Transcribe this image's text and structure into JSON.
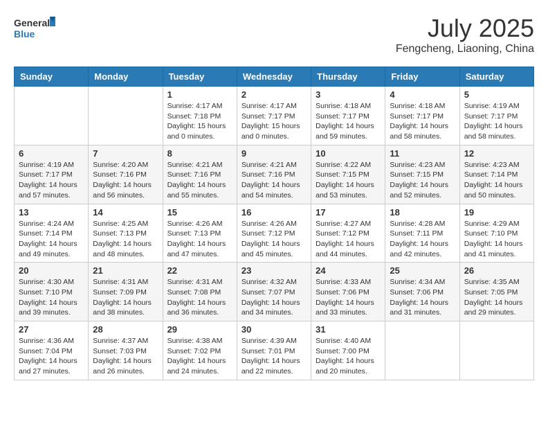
{
  "header": {
    "logo_text_general": "General",
    "logo_text_blue": "Blue",
    "month": "July 2025",
    "location": "Fengcheng, Liaoning, China"
  },
  "weekdays": [
    "Sunday",
    "Monday",
    "Tuesday",
    "Wednesday",
    "Thursday",
    "Friday",
    "Saturday"
  ],
  "weeks": [
    [
      {
        "day": "",
        "info": ""
      },
      {
        "day": "",
        "info": ""
      },
      {
        "day": "1",
        "info": "Sunrise: 4:17 AM\nSunset: 7:18 PM\nDaylight: 15 hours\nand 0 minutes."
      },
      {
        "day": "2",
        "info": "Sunrise: 4:17 AM\nSunset: 7:17 PM\nDaylight: 15 hours\nand 0 minutes."
      },
      {
        "day": "3",
        "info": "Sunrise: 4:18 AM\nSunset: 7:17 PM\nDaylight: 14 hours\nand 59 minutes."
      },
      {
        "day": "4",
        "info": "Sunrise: 4:18 AM\nSunset: 7:17 PM\nDaylight: 14 hours\nand 58 minutes."
      },
      {
        "day": "5",
        "info": "Sunrise: 4:19 AM\nSunset: 7:17 PM\nDaylight: 14 hours\nand 58 minutes."
      }
    ],
    [
      {
        "day": "6",
        "info": "Sunrise: 4:19 AM\nSunset: 7:17 PM\nDaylight: 14 hours\nand 57 minutes."
      },
      {
        "day": "7",
        "info": "Sunrise: 4:20 AM\nSunset: 7:16 PM\nDaylight: 14 hours\nand 56 minutes."
      },
      {
        "day": "8",
        "info": "Sunrise: 4:21 AM\nSunset: 7:16 PM\nDaylight: 14 hours\nand 55 minutes."
      },
      {
        "day": "9",
        "info": "Sunrise: 4:21 AM\nSunset: 7:16 PM\nDaylight: 14 hours\nand 54 minutes."
      },
      {
        "day": "10",
        "info": "Sunrise: 4:22 AM\nSunset: 7:15 PM\nDaylight: 14 hours\nand 53 minutes."
      },
      {
        "day": "11",
        "info": "Sunrise: 4:23 AM\nSunset: 7:15 PM\nDaylight: 14 hours\nand 52 minutes."
      },
      {
        "day": "12",
        "info": "Sunrise: 4:23 AM\nSunset: 7:14 PM\nDaylight: 14 hours\nand 50 minutes."
      }
    ],
    [
      {
        "day": "13",
        "info": "Sunrise: 4:24 AM\nSunset: 7:14 PM\nDaylight: 14 hours\nand 49 minutes."
      },
      {
        "day": "14",
        "info": "Sunrise: 4:25 AM\nSunset: 7:13 PM\nDaylight: 14 hours\nand 48 minutes."
      },
      {
        "day": "15",
        "info": "Sunrise: 4:26 AM\nSunset: 7:13 PM\nDaylight: 14 hours\nand 47 minutes."
      },
      {
        "day": "16",
        "info": "Sunrise: 4:26 AM\nSunset: 7:12 PM\nDaylight: 14 hours\nand 45 minutes."
      },
      {
        "day": "17",
        "info": "Sunrise: 4:27 AM\nSunset: 7:12 PM\nDaylight: 14 hours\nand 44 minutes."
      },
      {
        "day": "18",
        "info": "Sunrise: 4:28 AM\nSunset: 7:11 PM\nDaylight: 14 hours\nand 42 minutes."
      },
      {
        "day": "19",
        "info": "Sunrise: 4:29 AM\nSunset: 7:10 PM\nDaylight: 14 hours\nand 41 minutes."
      }
    ],
    [
      {
        "day": "20",
        "info": "Sunrise: 4:30 AM\nSunset: 7:10 PM\nDaylight: 14 hours\nand 39 minutes."
      },
      {
        "day": "21",
        "info": "Sunrise: 4:31 AM\nSunset: 7:09 PM\nDaylight: 14 hours\nand 38 minutes."
      },
      {
        "day": "22",
        "info": "Sunrise: 4:31 AM\nSunset: 7:08 PM\nDaylight: 14 hours\nand 36 minutes."
      },
      {
        "day": "23",
        "info": "Sunrise: 4:32 AM\nSunset: 7:07 PM\nDaylight: 14 hours\nand 34 minutes."
      },
      {
        "day": "24",
        "info": "Sunrise: 4:33 AM\nSunset: 7:06 PM\nDaylight: 14 hours\nand 33 minutes."
      },
      {
        "day": "25",
        "info": "Sunrise: 4:34 AM\nSunset: 7:06 PM\nDaylight: 14 hours\nand 31 minutes."
      },
      {
        "day": "26",
        "info": "Sunrise: 4:35 AM\nSunset: 7:05 PM\nDaylight: 14 hours\nand 29 minutes."
      }
    ],
    [
      {
        "day": "27",
        "info": "Sunrise: 4:36 AM\nSunset: 7:04 PM\nDaylight: 14 hours\nand 27 minutes."
      },
      {
        "day": "28",
        "info": "Sunrise: 4:37 AM\nSunset: 7:03 PM\nDaylight: 14 hours\nand 26 minutes."
      },
      {
        "day": "29",
        "info": "Sunrise: 4:38 AM\nSunset: 7:02 PM\nDaylight: 14 hours\nand 24 minutes."
      },
      {
        "day": "30",
        "info": "Sunrise: 4:39 AM\nSunset: 7:01 PM\nDaylight: 14 hours\nand 22 minutes."
      },
      {
        "day": "31",
        "info": "Sunrise: 4:40 AM\nSunset: 7:00 PM\nDaylight: 14 hours\nand 20 minutes."
      },
      {
        "day": "",
        "info": ""
      },
      {
        "day": "",
        "info": ""
      }
    ]
  ]
}
